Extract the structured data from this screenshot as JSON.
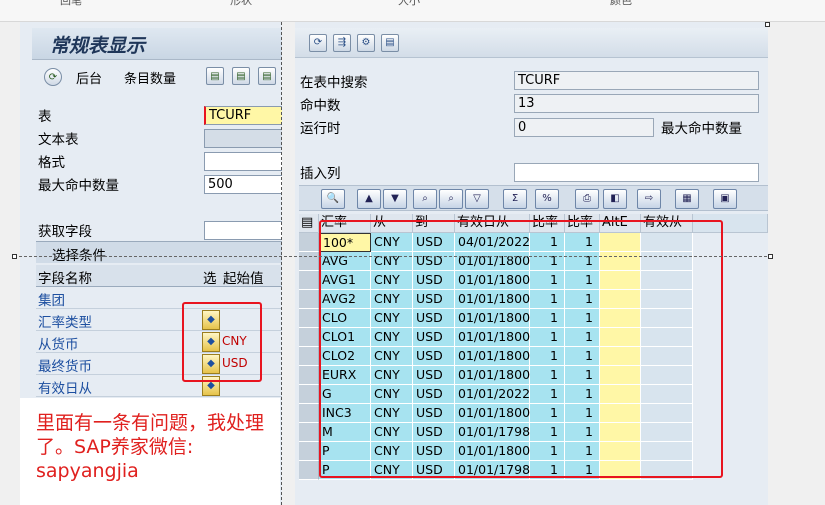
{
  "top_strip": {
    "labels": [
      "回笔",
      "形状",
      "大小",
      "颜色"
    ]
  },
  "left": {
    "title": "常规表显示",
    "toolbar": {
      "back_label": "后台",
      "count_label": "条目数量"
    },
    "fields": {
      "table_label": "表",
      "table_value": "TCURF",
      "text_table_label": "文本表",
      "text_table_value": "",
      "format_label": "格式",
      "format_value": "",
      "max_hits_label": "最大命中数量",
      "max_hits_value": "500",
      "fetch_fields_label": "获取字段",
      "fetch_fields_value": ""
    },
    "selection": {
      "header": "选择条件",
      "col_field": "字段名称",
      "col_sel": "选",
      "col_from": "起始值",
      "rows": [
        {
          "name": "集团",
          "value": ""
        },
        {
          "name": "汇率类型",
          "value": ""
        },
        {
          "name": "从货币",
          "value": "CNY"
        },
        {
          "name": "最终货币",
          "value": "USD"
        },
        {
          "name": "有效日从",
          "value": ""
        }
      ]
    }
  },
  "note": {
    "text": "里面有一条有问题，我处理了。SAP养家微信: sapyangjia"
  },
  "right": {
    "search_label": "在表中搜索",
    "search_value": "TCURF",
    "hits_label": "命中数",
    "hits_value": "13",
    "runtime_label": "运行时",
    "runtime_value": "0",
    "max_hits_label": "最大命中数量",
    "insert_col_label": "插入列",
    "insert_col_value": "",
    "grid": {
      "columns": [
        "汇率",
        "从",
        "到",
        "有效日从",
        "比率",
        "比率",
        "AltE",
        "有效从"
      ],
      "rows": [
        [
          "100*",
          "CNY",
          "USD",
          "04/01/2022",
          "1",
          "1",
          "",
          ""
        ],
        [
          "AVG",
          "CNY",
          "USD",
          "01/01/1800",
          "1",
          "1",
          "",
          ""
        ],
        [
          "AVG1",
          "CNY",
          "USD",
          "01/01/1800",
          "1",
          "1",
          "",
          ""
        ],
        [
          "AVG2",
          "CNY",
          "USD",
          "01/01/1800",
          "1",
          "1",
          "",
          ""
        ],
        [
          "CLO",
          "CNY",
          "USD",
          "01/01/1800",
          "1",
          "1",
          "",
          ""
        ],
        [
          "CLO1",
          "CNY",
          "USD",
          "01/01/1800",
          "1",
          "1",
          "",
          ""
        ],
        [
          "CLO2",
          "CNY",
          "USD",
          "01/01/1800",
          "1",
          "1",
          "",
          ""
        ],
        [
          "EURX",
          "CNY",
          "USD",
          "01/01/1800",
          "1",
          "1",
          "",
          ""
        ],
        [
          "G",
          "CNY",
          "USD",
          "01/01/2022",
          "1",
          "1",
          "",
          ""
        ],
        [
          "INC3",
          "CNY",
          "USD",
          "01/01/1800",
          "1",
          "1",
          "",
          ""
        ],
        [
          "M",
          "CNY",
          "USD",
          "01/01/1798",
          "1",
          "1",
          "",
          ""
        ],
        [
          "P",
          "CNY",
          "USD",
          "01/01/1800",
          "1",
          "1",
          "",
          ""
        ],
        [
          "P",
          "CNY",
          "USD",
          "01/01/1798",
          "1",
          "1",
          "",
          ""
        ]
      ]
    }
  },
  "colors": {
    "highlight_red": "#e8141f",
    "cell_blue": "#a7e3f0",
    "cell_yellow": "#fff7a6",
    "link_blue": "#1d4fa0"
  }
}
